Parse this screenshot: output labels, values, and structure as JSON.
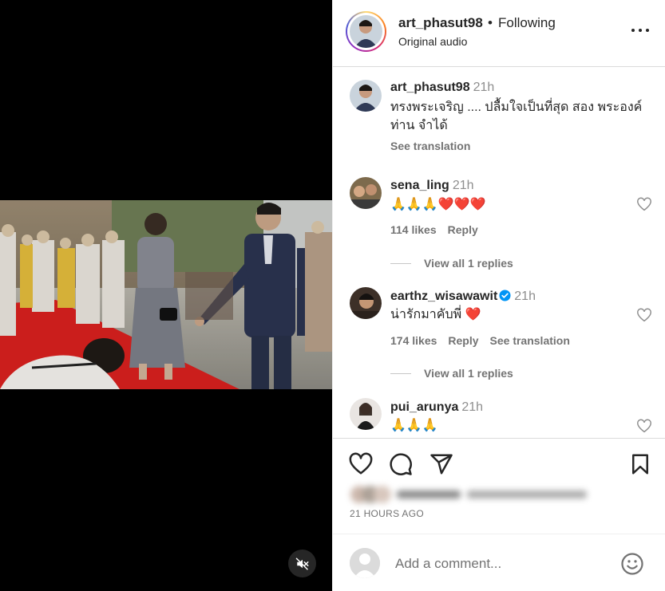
{
  "post": {
    "author": "art_phasut98",
    "dot": "•",
    "follow_status": "Following",
    "audio": "Original audio",
    "caption_user": "art_phasut98",
    "caption_time": "21h",
    "caption_text": "ทรงพระเจริญ .... ปลื้มใจเป็นที่สุด สอง พระองค์ท่าน จำได้",
    "see_translation": "See translation"
  },
  "comments": [
    {
      "user": "sena_ling",
      "time": "21h",
      "text": "🙏🙏🙏❤️❤️❤️",
      "likes": "114 likes",
      "reply": "Reply",
      "view_replies": "View all 1 replies"
    },
    {
      "user": "earthz_wisawawit",
      "time": "21h",
      "verified": true,
      "text": "น่ารักมาคับพี่ ❤️",
      "likes": "174 likes",
      "reply": "Reply",
      "see_translation": "See translation",
      "view_replies": "View all 1 replies"
    },
    {
      "user": "pui_arunya",
      "time": "21h",
      "text": "🙏🙏🙏"
    }
  ],
  "footer": {
    "timestamp": "21 HOURS AGO",
    "add_comment_placeholder": "Add a comment..."
  },
  "icons": {
    "mute": "speaker-muted-icon",
    "more": "more-options-icon",
    "like": "heart-icon",
    "comment": "comment-bubble-icon",
    "share": "paper-plane-icon",
    "save": "bookmark-icon",
    "emoji": "emoji-icon"
  },
  "colors": {
    "verified": "#0095f6",
    "heart_red": "#ed4956",
    "muted_text": "#737373"
  }
}
